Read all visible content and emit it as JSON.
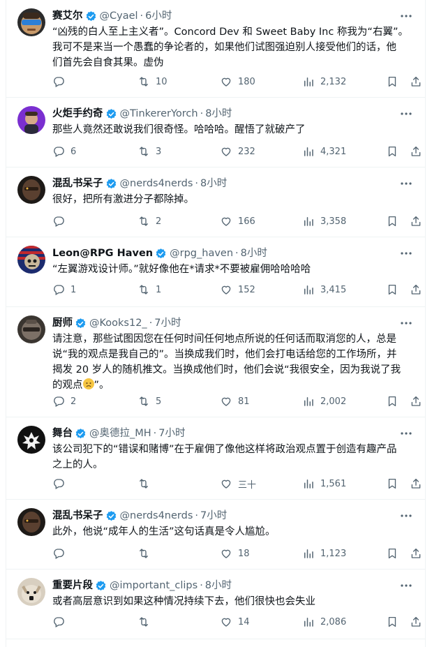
{
  "tweets": [
    {
      "name": "赛艾尔",
      "handle": "@Cyael",
      "dot": "·",
      "time": "6小时",
      "text": "“凶残的白人至上主义者”。Concord Dev 和 Sweet Baby Inc 称我为“右翼”。\n我可不是来当一个愚蠢的争论者的，如果他们试图强迫别人接受他们的话，他\n们首先会自食其果。虚伪",
      "replies": "",
      "retweets": "10",
      "likes": "180",
      "views": "2,132",
      "avatar": "sunglasses-avatar"
    },
    {
      "name": "火炬手约奇",
      "handle": "@TinkererYorch",
      "dot": "·",
      "time": "8小时",
      "text": "那些人竟然还敢说我们很奇怪。哈哈哈。醒悟了就破产了",
      "replies": "6",
      "retweets": "3",
      "likes": "232",
      "views": "4,321",
      "avatar": "purple-avatar"
    },
    {
      "name": "混乱书呆子",
      "handle": "@nerds4nerds",
      "dot": "·",
      "time": "8小时",
      "text": "很好，把所有激进分子都除掉。",
      "replies": "",
      "retweets": "2",
      "likes": "166",
      "views": "3,358",
      "avatar": "dark-helmet-avatar"
    },
    {
      "name": "Leon@RPG Haven",
      "handle": "@rpg_haven",
      "dot": "·",
      "time": "8小时",
      "text": "“左翼游戏设计师。”就好像他在*请求*不要被雇佣哈哈哈哈",
      "replies": "1",
      "retweets": "1",
      "likes": "152",
      "views": "3,415",
      "avatar": "flag-skull-avatar"
    },
    {
      "name": "厨师",
      "handle": "@Kooks12_",
      "dot": "·",
      "time": "7小时",
      "text": "请注意，那些试图因您在任何时间任何地点所说的任何话而取消您的人，总是\n说“我的观点是我自己的”。当换成我们时，他们会打电话给您的工作场所，并\n揭发 20 岁人的随机推文。当换成他们时，他们会说“我很安全，因为我说了我\n的观点",
      "text_tail": "”。",
      "replies": "2",
      "retweets": "5",
      "likes": "81",
      "views": "2,002",
      "avatar": "helmet-avatar"
    },
    {
      "name": "舞台",
      "handle": "@奥德拉_MH",
      "dot": "·",
      "time": "7小时",
      "text": "该公司犯下的“错误和赌博”在于雇佣了像他这样将政治观点置于创造有趣产品\n之上的人。",
      "replies": "",
      "retweets": "",
      "likes": "三十",
      "views": "1,561",
      "avatar": "white-emblem-avatar"
    },
    {
      "name": "混乱书呆子",
      "handle": "@nerds4nerds",
      "dot": "·",
      "time": "7小时",
      "text": "此外，他说“成年人的生活”这句话真是令人尴尬。",
      "replies": "",
      "retweets": "",
      "likes": "18",
      "views": "1,123",
      "avatar": "dark-helmet-avatar"
    },
    {
      "name": "重要片段",
      "handle": "@important_clips",
      "dot": "·",
      "time": "8小时",
      "text": "或者高层意识到如果这种情况持续下去，他们很快也会失业",
      "replies": "",
      "retweets": "",
      "likes": "14",
      "views": "2,086",
      "avatar": "cat-avatar"
    }
  ],
  "colors": {
    "verified": "#1d9bf0",
    "muted": "#536471",
    "text": "#0f1419",
    "divider": "#eff3f4"
  }
}
